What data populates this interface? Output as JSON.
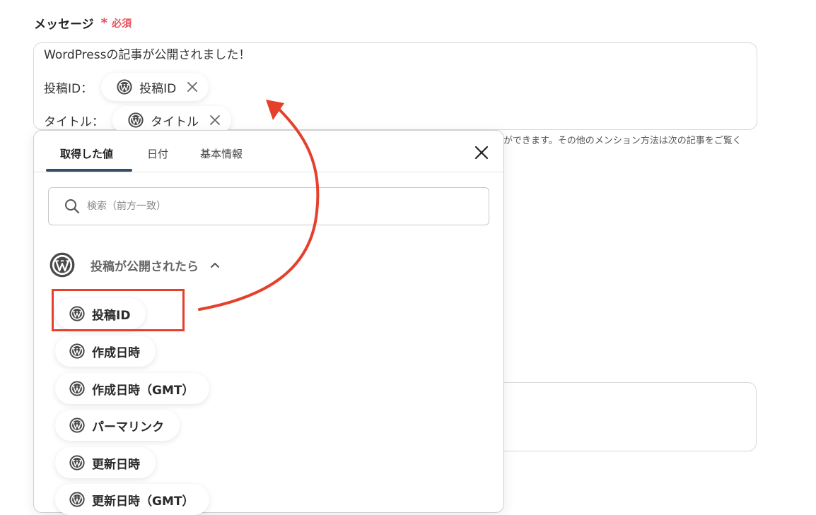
{
  "field": {
    "label": "メッセージ",
    "required_star": "*",
    "required_text": "必須"
  },
  "message": {
    "line1": "WordPressの記事が公開されました！",
    "line2_prefix": "投稿ID：",
    "line2_chip": "投稿ID",
    "line3_prefix": "タイトル：",
    "line3_chip": "タイトル"
  },
  "hint_text": "ができます。その他のメンション方法は次の記事をご覧く",
  "panel": {
    "tabs": [
      {
        "label": "取得した値",
        "active": true
      },
      {
        "label": "日付",
        "active": false
      },
      {
        "label": "基本情報",
        "active": false
      }
    ],
    "search": {
      "placeholder": "検索（前方一致）",
      "value": ""
    },
    "group_title": "投稿が公開されたら",
    "items": [
      {
        "label": "投稿ID",
        "highlighted": true
      },
      {
        "label": "作成日時"
      },
      {
        "label": "作成日時（GMT）"
      },
      {
        "label": "パーマリンク"
      },
      {
        "label": "更新日時"
      },
      {
        "label": "更新日時（GMT）"
      }
    ]
  },
  "icons": {
    "wordpress": "wordpress-logo-icon",
    "remove": "close-icon",
    "close": "close-icon",
    "search": "search-icon",
    "collapse": "chevron-up-icon"
  },
  "colors": {
    "required": "#e8505b",
    "tab_underline": "#334e66",
    "annotation": "#e5402c"
  }
}
